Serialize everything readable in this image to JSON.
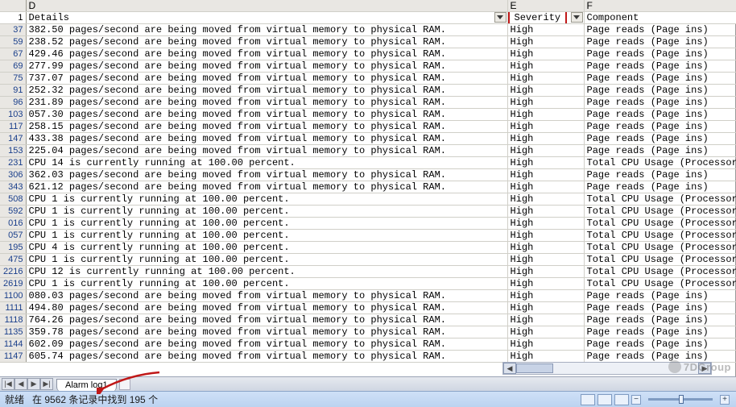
{
  "columns": {
    "D": "D",
    "E": "E",
    "F": "F"
  },
  "headers": {
    "details": "Details",
    "severity": "Severity",
    "component": "Component"
  },
  "severity_value": "High",
  "components": {
    "page_reads": "Page reads (Page ins)",
    "cpu": "Total CPU Usage (Processor "
  },
  "rows": [
    {
      "n": "1",
      "type": "header"
    },
    {
      "n": "37",
      "d": "382.50 pages/second are being moved from virtual memory to physical RAM.",
      "c": "page_reads"
    },
    {
      "n": "59",
      "d": "238.52 pages/second are being moved from virtual memory to physical RAM.",
      "c": "page_reads"
    },
    {
      "n": "67",
      "d": "429.46 pages/second are being moved from virtual memory to physical RAM.",
      "c": "page_reads"
    },
    {
      "n": "69",
      "d": "277.99 pages/second are being moved from virtual memory to physical RAM.",
      "c": "page_reads"
    },
    {
      "n": "75",
      "d": "737.07 pages/second are being moved from virtual memory to physical RAM.",
      "c": "page_reads"
    },
    {
      "n": "91",
      "d": "252.32 pages/second are being moved from virtual memory to physical RAM.",
      "c": "page_reads"
    },
    {
      "n": "96",
      "d": "231.89 pages/second are being moved from virtual memory to physical RAM.",
      "c": "page_reads"
    },
    {
      "n": "103",
      "d": "057.30 pages/second are being moved from virtual memory to physical RAM.",
      "c": "page_reads"
    },
    {
      "n": "117",
      "d": "258.15 pages/second are being moved from virtual memory to physical RAM.",
      "c": "page_reads"
    },
    {
      "n": "147",
      "d": "433.38 pages/second are being moved from virtual memory to physical RAM.",
      "c": "page_reads"
    },
    {
      "n": "153",
      "d": "225.04 pages/second are being moved from virtual memory to physical RAM.",
      "c": "page_reads"
    },
    {
      "n": "231",
      "d": "CPU 14 is currently running at 100.00 percent.",
      "c": "cpu"
    },
    {
      "n": "306",
      "d": "362.03 pages/second are being moved from virtual memory to physical RAM.",
      "c": "page_reads"
    },
    {
      "n": "343",
      "d": "621.12 pages/second are being moved from virtual memory to physical RAM.",
      "c": "page_reads"
    },
    {
      "n": "508",
      "d": "CPU 1 is currently running at 100.00 percent.",
      "c": "cpu"
    },
    {
      "n": "592",
      "d": "CPU 1 is currently running at 100.00 percent.",
      "c": "cpu"
    },
    {
      "n": "016",
      "d": "CPU 1 is currently running at 100.00 percent.",
      "c": "cpu"
    },
    {
      "n": "057",
      "d": "CPU 1 is currently running at 100.00 percent.",
      "c": "cpu"
    },
    {
      "n": "195",
      "d": "CPU 4 is currently running at 100.00 percent.",
      "c": "cpu"
    },
    {
      "n": "475",
      "d": "CPU 1 is currently running at 100.00 percent.",
      "c": "cpu"
    },
    {
      "n": "2216",
      "d": "CPU 12 is currently running at 100.00 percent.",
      "c": "cpu"
    },
    {
      "n": "2619",
      "d": "CPU 1 is currently running at 100.00 percent.",
      "c": "cpu"
    },
    {
      "n": "1100",
      "d": "080.03 pages/second are being moved from virtual memory to physical RAM.",
      "c": "page_reads"
    },
    {
      "n": "1111",
      "d": "494.80 pages/second are being moved from virtual memory to physical RAM.",
      "c": "page_reads"
    },
    {
      "n": "1118",
      "d": "764.26 pages/second are being moved from virtual memory to physical RAM.",
      "c": "page_reads"
    },
    {
      "n": "1135",
      "d": "359.78 pages/second are being moved from virtual memory to physical RAM.",
      "c": "page_reads"
    },
    {
      "n": "1144",
      "d": "602.09 pages/second are being moved from virtual memory to physical RAM.",
      "c": "page_reads"
    },
    {
      "n": "1147",
      "d": "605.74 pages/second are being moved from virtual memory to physical RAM.",
      "c": "page_reads"
    }
  ],
  "sheet_tab": "Alarm log1",
  "status": {
    "ready": "就绪",
    "filter_msg": "在 9562 条记录中找到 195 个"
  },
  "watermark": "7DGroup",
  "tab_nav": {
    "first": "|◀",
    "prev": "◀",
    "next": "▶",
    "last": "▶|"
  }
}
